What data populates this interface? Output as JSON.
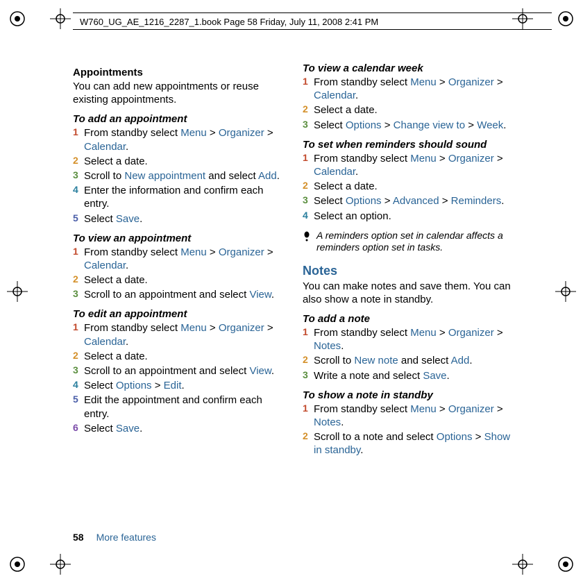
{
  "header": {
    "running": "W760_UG_AE_1216_2287_1.book  Page 58  Friday, July 11, 2008  2:41 PM"
  },
  "footer": {
    "page_number": "58",
    "section": "More features"
  },
  "left": {
    "appointments_heading": "Appointments",
    "appointments_intro": "You can add new appointments or reuse existing appointments.",
    "add_heading": "To add an appointment",
    "add": {
      "s1a": "From standby select ",
      "s1_menu": "Menu",
      "s1_g1": " > ",
      "s1_org": "Organizer",
      "s1_g2": " > ",
      "s1_cal": "Calendar",
      "s1_end": ".",
      "s2": "Select a date.",
      "s3a": "Scroll to ",
      "s3_new": "New appointment",
      "s3b": " and select ",
      "s3_add": "Add",
      "s3_end": ".",
      "s4": "Enter the information and confirm each entry.",
      "s5a": "Select ",
      "s5_save": "Save",
      "s5_end": "."
    },
    "view_heading": "To view an appointment",
    "view": {
      "s1a": "From standby select ",
      "s1_menu": "Menu",
      "s1_g1": " > ",
      "s1_org": "Organizer",
      "s1_g2": " > ",
      "s1_cal": "Calendar",
      "s1_end": ".",
      "s2": "Select a date.",
      "s3a": "Scroll to an appointment and select ",
      "s3_view": "View",
      "s3_end": "."
    },
    "edit_heading": "To edit an appointment",
    "edit": {
      "s1a": "From standby select ",
      "s1_menu": "Menu",
      "s1_g1": " > ",
      "s1_org": "Organizer",
      "s1_g2": " > ",
      "s1_cal": "Calendar",
      "s1_end": ".",
      "s2": "Select a date.",
      "s3a": "Scroll to an appointment and select ",
      "s3_view": "View",
      "s3_end": ".",
      "s4a": "Select ",
      "s4_opt": "Options",
      "s4_g": " > ",
      "s4_edit": "Edit",
      "s4_end": ".",
      "s5": "Edit the appointment and confirm each entry.",
      "s6a": "Select ",
      "s6_save": "Save",
      "s6_end": "."
    }
  },
  "right": {
    "week_heading": "To view a calendar week",
    "week": {
      "s1a": "From standby select ",
      "s1_menu": "Menu",
      "s1_g1": " > ",
      "s1_org": "Organizer",
      "s1_g2": " > ",
      "s1_cal": "Calendar",
      "s1_end": ".",
      "s2": "Select a date.",
      "s3a": "Select ",
      "s3_opt": "Options",
      "s3_g1": " > ",
      "s3_cvt": "Change view to",
      "s3_g2": " > ",
      "s3_week": "Week",
      "s3_end": "."
    },
    "rem_heading": "To set when reminders should sound",
    "reminders": {
      "s1a": "From standby select ",
      "s1_menu": "Menu",
      "s1_g1": " > ",
      "s1_org": "Organizer",
      "s1_g2": " > ",
      "s1_cal": "Calendar",
      "s1_end": ".",
      "s2": "Select a date.",
      "s3a": "Select ",
      "s3_opt": "Options",
      "s3_g1": " > ",
      "s3_adv": "Advanced",
      "s3_g2": " > ",
      "s3_rem": "Reminders",
      "s3_end": ".",
      "s4": "Select an option."
    },
    "note_text": "A reminders option set in calendar affects a reminders option set in tasks.",
    "notes_heading": "Notes",
    "notes_intro": "You can make notes and save them. You can also show a note in standby.",
    "addnote_heading": "To add a note",
    "addnote": {
      "s1a": "From standby select ",
      "s1_menu": "Menu",
      "s1_g1": " > ",
      "s1_org": "Organizer",
      "s1_g2": " > ",
      "s1_notes": "Notes",
      "s1_end": ".",
      "s2a": "Scroll to ",
      "s2_new": "New note",
      "s2b": " and select ",
      "s2_add": "Add",
      "s2_end": ".",
      "s3a": "Write a note and select ",
      "s3_save": "Save",
      "s3_end": "."
    },
    "shownote_heading": "To show a note in standby",
    "shownote": {
      "s1a": "From standby select ",
      "s1_menu": "Menu",
      "s1_g1": " > ",
      "s1_org": "Organizer",
      "s1_g2": " > ",
      "s1_notes": "Notes",
      "s1_end": ".",
      "s2a": "Scroll to a note and select ",
      "s2_opt": "Options",
      "s2_g": " > ",
      "s2_show": "Show in standby",
      "s2_end": "."
    }
  }
}
